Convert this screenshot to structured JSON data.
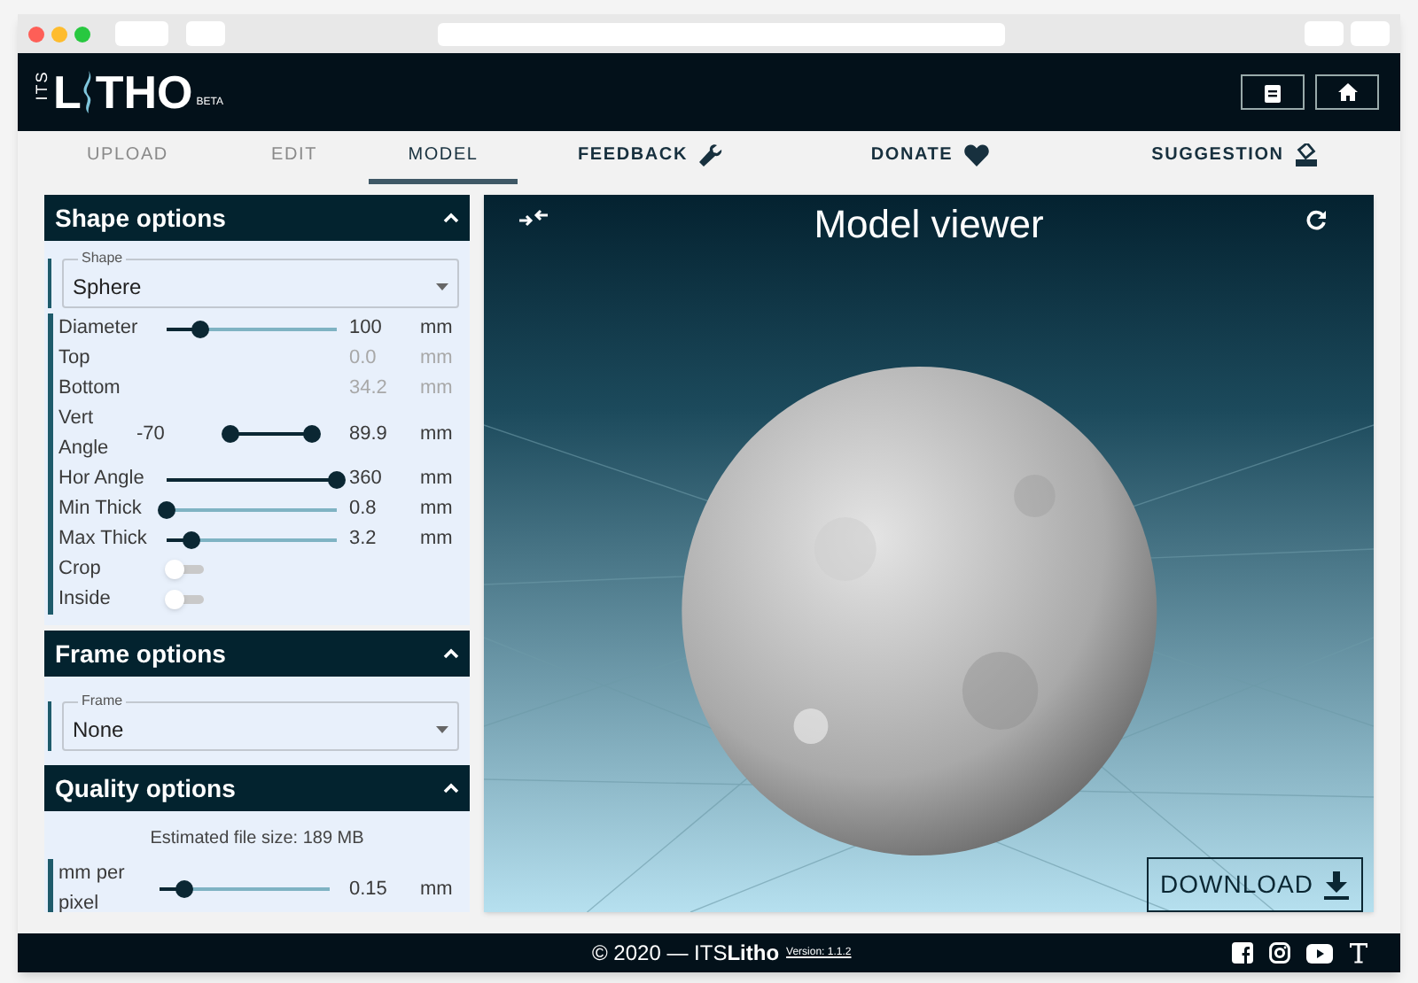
{
  "logo": {
    "prefix": "ITS",
    "first": "L",
    "rest": "THO",
    "badge": "BETA"
  },
  "tabs": [
    {
      "label": "UPLOAD",
      "selected": false
    },
    {
      "label": "EDIT",
      "selected": false
    },
    {
      "label": "MODEL",
      "selected": true
    },
    {
      "label": "FEEDBACK",
      "selected": false
    },
    {
      "label": "DONATE",
      "selected": false
    },
    {
      "label": "SUGGESTION",
      "selected": false
    }
  ],
  "shape_options": {
    "title": "Shape options",
    "expanded": true,
    "select": {
      "label": "Shape",
      "value": "Sphere"
    },
    "rows": [
      {
        "kind": "slider",
        "label": "Diameter",
        "level": 0.2,
        "value": "100",
        "unit": "mm",
        "disabled": false
      },
      {
        "kind": "readonly",
        "label": "Top",
        "value": "0.0",
        "unit": "mm",
        "disabled": true
      },
      {
        "kind": "readonly",
        "label": "Bottom",
        "value": "34.2",
        "unit": "mm",
        "disabled": true
      },
      {
        "kind": "range",
        "label": "Vert Angle",
        "min": "-70",
        "level": 1.0,
        "value": "89.9",
        "unit": "mm",
        "disabled": false
      },
      {
        "kind": "slider",
        "label": "Hor Angle",
        "level": 1.0,
        "value": "360",
        "unit": "mm",
        "disabled": false
      },
      {
        "kind": "slider",
        "label": "Min Thick",
        "level": 0.0,
        "value": "0.8",
        "unit": "mm",
        "disabled": false
      },
      {
        "kind": "slider",
        "label": "Max Thick",
        "level": 0.15,
        "value": "3.2",
        "unit": "mm",
        "disabled": false
      },
      {
        "kind": "toggle",
        "label": "Crop",
        "on": false
      },
      {
        "kind": "toggle",
        "label": "Inside",
        "on": false
      }
    ]
  },
  "frame_options": {
    "title": "Frame options",
    "expanded": true,
    "select": {
      "label": "Frame",
      "value": "None"
    }
  },
  "quality_options": {
    "title": "Quality options",
    "expanded": true,
    "estimate": "Estimated file size: 189 MB",
    "rows": [
      {
        "kind": "slider",
        "label": "mm per pixel",
        "level": 0.15,
        "value": "0.15",
        "unit": "mm",
        "disabled": false
      }
    ]
  },
  "viewer": {
    "title": "Model viewer",
    "download": "DOWNLOAD"
  },
  "footer": {
    "copyright": "© 2020 — ITS**Litho**",
    "version": "Version: 1.1.2"
  }
}
